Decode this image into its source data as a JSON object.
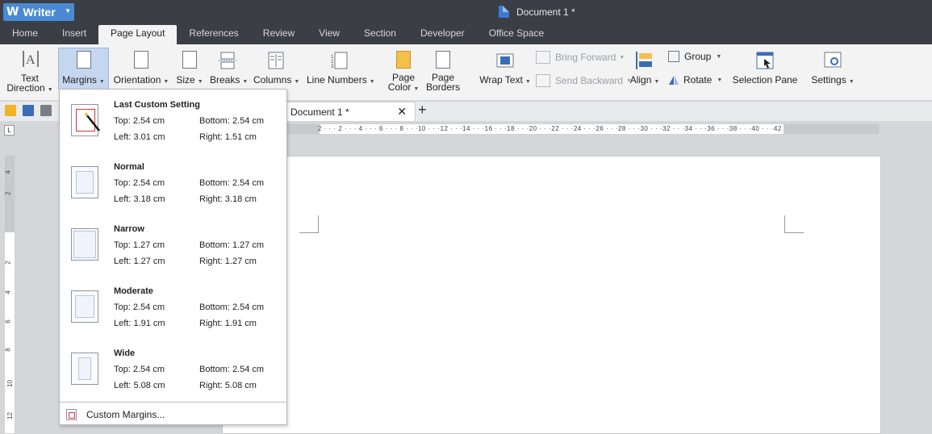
{
  "app": {
    "name": "Writer",
    "doc_title": "Document 1 *"
  },
  "menu": [
    "Home",
    "Insert",
    "Page Layout",
    "References",
    "Review",
    "View",
    "Section",
    "Developer",
    "Office Space"
  ],
  "ribbon": {
    "text_direction": "Text\nDirection",
    "text_direction_l1": "Text",
    "text_direction_l2": "Direction",
    "margins": "Margins",
    "orientation": "Orientation",
    "size": "Size",
    "breaks": "Breaks",
    "columns": "Columns",
    "line_numbers": "Line Numbers",
    "page_color_l1": "Page",
    "page_color_l2": "Color",
    "page_borders_l1": "Page",
    "page_borders_l2": "Borders",
    "wrap_text": "Wrap Text",
    "bring_forward": "Bring Forward",
    "send_backward": "Send Backward",
    "align": "Align",
    "group": "Group",
    "rotate": "Rotate",
    "selection_pane": "Selection Pane",
    "settings": "Settings"
  },
  "doc_tab": {
    "label": "Document 1 *"
  },
  "ruler_h": "2 · · · 2 · · · 4 · · · 6 · · · 8 · · ·10 · · ·12 · · ·14 · · ·16 · · ·18 · · ·20 · · ·22 · · ·24 · · ·26 · · ·28 · · ·30 · · ·32 · · ·34 · · ·36 · · ·38 · · ·40 · · ·42",
  "ruler_v": [
    "4",
    "2",
    "2",
    "4",
    "6",
    "8",
    "10",
    "12"
  ],
  "margins_menu": {
    "options": [
      {
        "name": "Last Custom Setting",
        "top": "Top: 2.54 cm",
        "bottom": "Bottom: 2.54 cm",
        "left": "Left: 3.01 cm",
        "right": "Right: 1.51 cm"
      },
      {
        "name": "Normal",
        "top": "Top: 2.54 cm",
        "bottom": "Bottom: 2.54 cm",
        "left": "Left: 3.18 cm",
        "right": "Right: 3.18 cm"
      },
      {
        "name": "Narrow",
        "top": "Top: 1.27 cm",
        "bottom": "Bottom: 1.27 cm",
        "left": "Left: 1.27 cm",
        "right": "Right: 1.27 cm"
      },
      {
        "name": "Moderate",
        "top": "Top: 2.54 cm",
        "bottom": "Bottom: 2.54 cm",
        "left": "Left: 1.91 cm",
        "right": "Right: 1.91 cm"
      },
      {
        "name": "Wide",
        "top": "Top: 2.54 cm",
        "bottom": "Bottom: 2.54 cm",
        "left": "Left: 5.08 cm",
        "right": "Right: 5.08 cm"
      }
    ],
    "custom": "Custom Margins..."
  },
  "colors": {
    "titlebar": "#3b3e45",
    "accent": "#4a8ad4",
    "highlight": "#c4d7ef"
  }
}
